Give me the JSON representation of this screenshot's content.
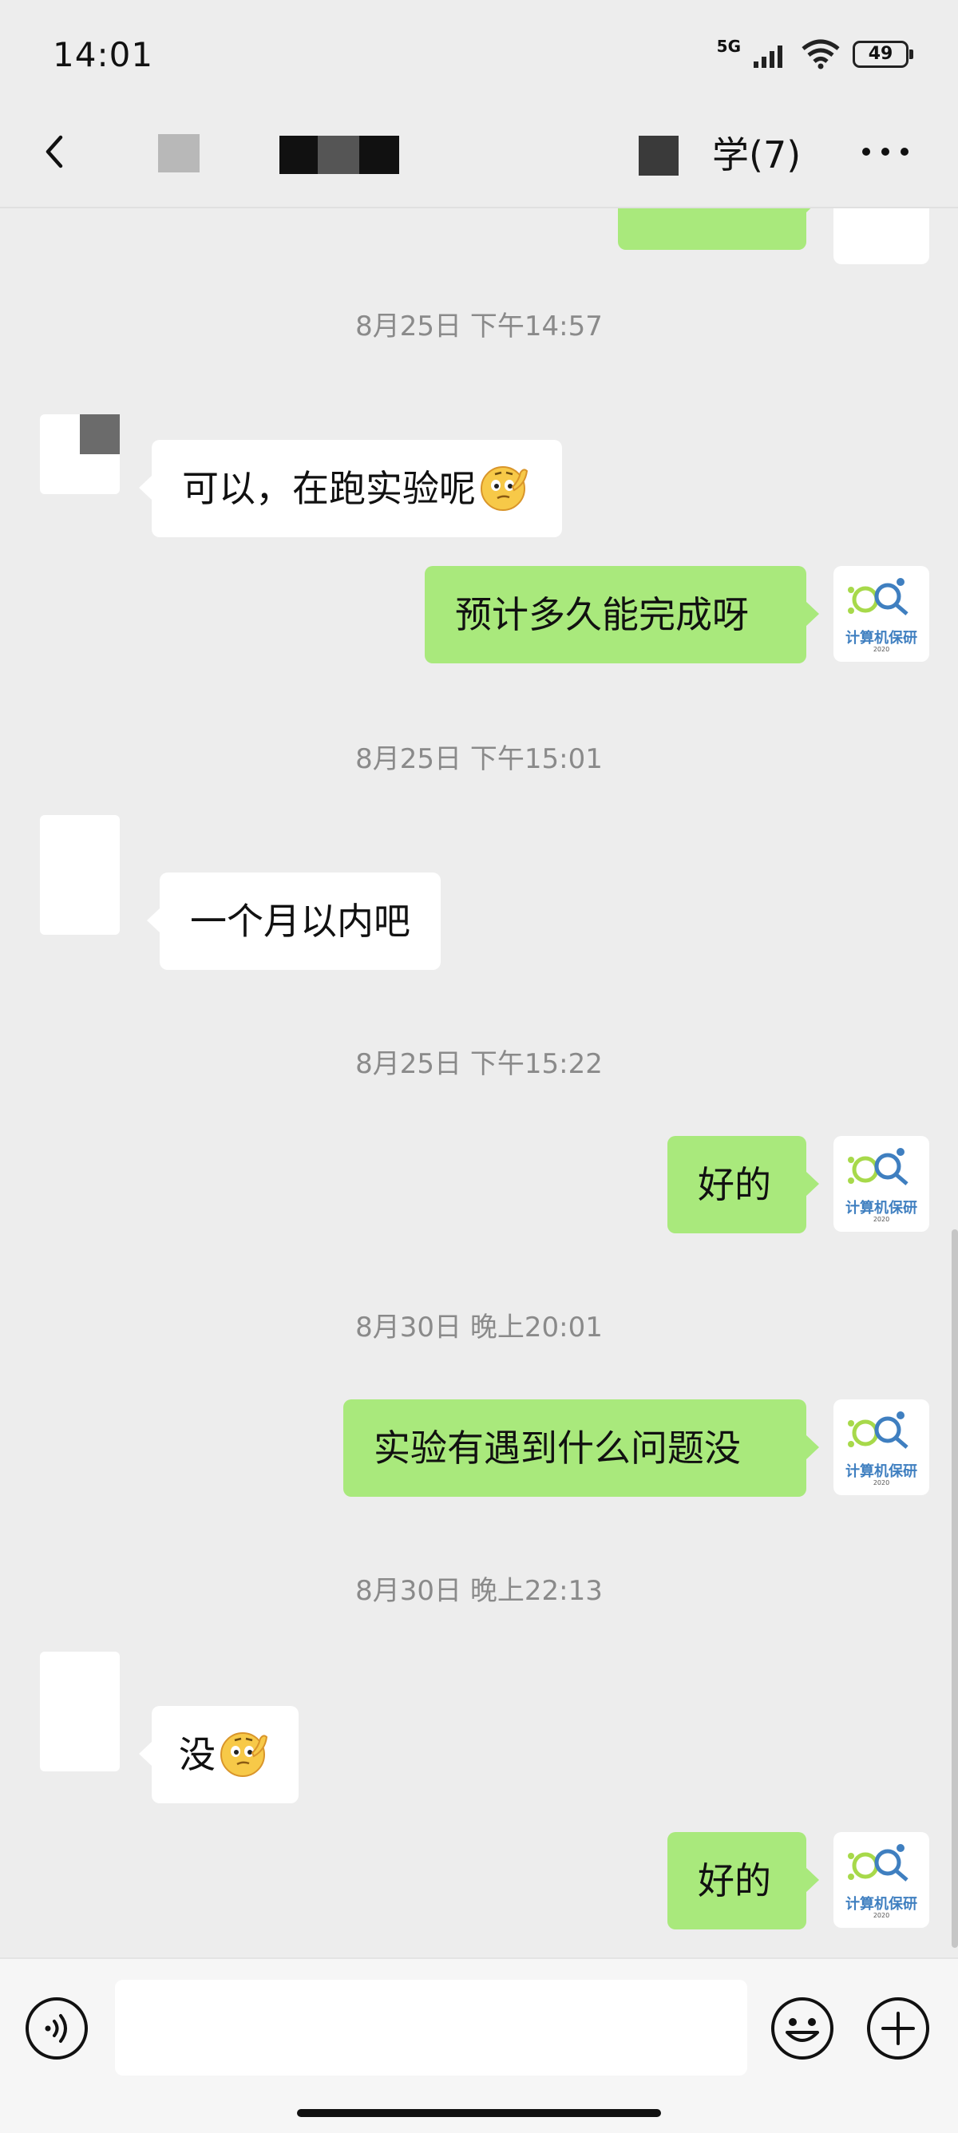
{
  "status_bar": {
    "time": "14:01",
    "network": "5G",
    "battery": "49"
  },
  "header": {
    "title_suffix": "学(7)"
  },
  "messages": [
    {
      "type": "time",
      "text": "8月25日 下午14:57"
    },
    {
      "type": "received",
      "text": "可以，在跑实验呢",
      "emoji": true
    },
    {
      "type": "sent",
      "text": "预计多久能完成呀"
    },
    {
      "type": "time",
      "text": "8月25日 下午15:01"
    },
    {
      "type": "received",
      "text": "一个月以内吧"
    },
    {
      "type": "time",
      "text": "8月25日 下午15:22"
    },
    {
      "type": "sent",
      "text": "好的"
    },
    {
      "type": "time",
      "text": "8月30日 晚上20:01"
    },
    {
      "type": "sent",
      "text": "实验有遇到什么问题没"
    },
    {
      "type": "time",
      "text": "8月30日 晚上22:13"
    },
    {
      "type": "received",
      "text": "没",
      "emoji": true
    },
    {
      "type": "sent",
      "text": "好的"
    }
  ],
  "avatar_mine": {
    "logo_text": "计算机保研",
    "logo_year": "2020"
  },
  "icons": {
    "back": "chevron-left-icon",
    "more": "more-dots-icon",
    "voice": "voice-icon",
    "emoji": "smiley-icon",
    "plus": "plus-icon",
    "reaction": "thinking-emoji-icon"
  },
  "colors": {
    "sent_bubble": "#a9e97c",
    "received_bubble": "#ffffff",
    "background": "#ededed"
  }
}
